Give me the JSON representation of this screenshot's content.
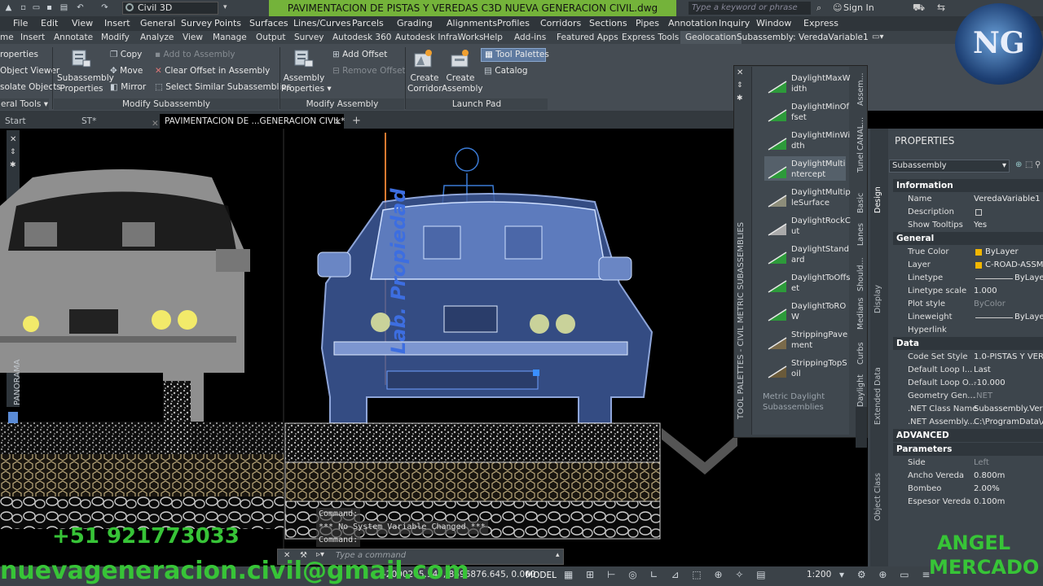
{
  "workspace": "Civil 3D",
  "document_title": "PAVIMENTACION DE PISTAS Y VEREDAS C3D NUEVA GENERACION CIVIL.dwg",
  "search_placeholder": "Type a keyword or phrase",
  "signin": "Sign In",
  "menu": [
    "File",
    "Edit",
    "View",
    "Insert",
    "General",
    "Survey",
    "Points",
    "Surfaces",
    "Lines/Curves",
    "Parcels",
    "Grading",
    "Alignments",
    "Profiles",
    "Corridors",
    "Sections",
    "Pipes",
    "Annotation",
    "Inquiry",
    "Window",
    "Express"
  ],
  "ribbon_tabs": [
    "me",
    "Insert",
    "Annotate",
    "Modify",
    "Analyze",
    "View",
    "Manage",
    "Output",
    "Survey",
    "Autodesk 360",
    "Autodesk InfraWorks",
    "Help",
    "Add-ins",
    "Featured Apps",
    "Express Tools",
    "Geolocation",
    "Subassembly: VeredaVariable1"
  ],
  "ribbon": {
    "properties_left": [
      "roperties",
      "Object Viewer",
      "solate Objects",
      "eral Tools"
    ],
    "subassembly_properties": [
      "Subassembly",
      "Properties"
    ],
    "copy": "Copy",
    "move": "Move",
    "mirror": "Mirror",
    "add_to_assembly": "Add to Assembly",
    "clear_offset": "Clear Offset in Assembly",
    "select_similar": "Select Similar Subassemblies",
    "modify_subassembly_label": "Modify Subassembly",
    "assembly_properties": [
      "Assembly",
      "Properties"
    ],
    "add_offset": "Add Offset",
    "remove_offset": "Remove Offset",
    "modify_assembly_label": "Modify Assembly",
    "create_corridor": [
      "Create",
      "Corridor"
    ],
    "create_assembly": [
      "Create",
      "Assembly"
    ],
    "tool_palettes": "Tool Palettes",
    "catalog": "Catalog",
    "launch_pad_label": "Launch Pad"
  },
  "doc_tabs": [
    "Start",
    "ST*",
    "PAVIMENTACION DE ...GENERACION CIVIL*"
  ],
  "palette": {
    "title": "TOOL PALETTES - CIVIL METRIC SUBASSEMBLIES",
    "items": [
      "DaylightMaxWidth",
      "DaylightMinOffset",
      "DaylightMinWidth",
      "DaylightMultiIntercept",
      "DaylightMultipleSurface",
      "DaylightRockCut",
      "DaylightStandard",
      "DaylightToOffset",
      "DaylightToROW",
      "StrippingPavement",
      "StrippingTopSoil"
    ],
    "items_display": [
      [
        "DaylightMaxW",
        "idth"
      ],
      [
        "DaylightMinOf",
        "fset"
      ],
      [
        "DaylightMinWi",
        "dth"
      ],
      [
        "DaylightMulti",
        "ntercept"
      ],
      [
        "DaylightMultip",
        "leSurface"
      ],
      [
        "DaylightRockC",
        "ut"
      ],
      [
        "DaylightStand",
        "ard"
      ],
      [
        "DaylightToOffs",
        "et"
      ],
      [
        "DaylightToRO",
        "W"
      ],
      [
        "StrippingPave",
        "ment"
      ],
      [
        "StrippingTopS",
        "oil"
      ]
    ],
    "footer": [
      "Metric Daylight",
      "Subassemblies"
    ],
    "side_tabs": [
      "Assem...",
      "CANAL...",
      "Tunel",
      "Basic",
      "Lanes",
      "Should...",
      "Medians",
      "Curbs",
      "Daylight"
    ]
  },
  "properties": {
    "title": "PROPERTIES",
    "selector": "Subassembly",
    "side_tabs": [
      "Design",
      "Display",
      "Extended Data",
      "Object Class"
    ],
    "sections": [
      {
        "name": "Information",
        "rows": [
          [
            "Name",
            "VeredaVariable1"
          ],
          [
            "Description",
            ""
          ],
          [
            "Show Tooltips",
            "Yes"
          ]
        ]
      },
      {
        "name": "General",
        "rows": [
          [
            "True Color",
            "ByLayer"
          ],
          [
            "Layer",
            "C-ROAD-ASSM"
          ],
          [
            "Linetype",
            "ByLayer"
          ],
          [
            "Linetype scale",
            "1.000"
          ],
          [
            "Plot style",
            "ByColor"
          ],
          [
            "Lineweight",
            "ByLayer"
          ],
          [
            "Hyperlink",
            ""
          ]
        ]
      },
      {
        "name": "Data",
        "rows": [
          [
            "Code Set Style",
            "1.0-PISTAS Y VERE"
          ],
          [
            "Default Loop I...",
            "Last"
          ],
          [
            "Default Loop O...",
            "-10.000"
          ],
          [
            "Geometry Gen...",
            ".NET"
          ],
          [
            ".NET Class Name",
            "Subassembly.Vered"
          ],
          [
            ".NET Assembly...",
            "C:\\ProgramData\\Au"
          ]
        ]
      },
      {
        "name": "ADVANCED",
        "rows": []
      },
      {
        "name": "Parameters",
        "rows": [
          [
            "Side",
            "Left"
          ],
          [
            "Ancho Vereda",
            "0.800m"
          ],
          [
            "Bombeo",
            "2.00%"
          ],
          [
            "Espesor Vereda",
            "0.100m"
          ]
        ]
      }
    ]
  },
  "command": {
    "history": [
      "Command:",
      "*** No System Variable Changed ***",
      "Command:"
    ],
    "placeholder": "Type a command"
  },
  "status": {
    "coords": "-2000205.547, 8696876.645, 0.000",
    "model": "MODEL",
    "scale": "1:200"
  },
  "canvas_text": {
    "vertical_watermark": "Lab. Propiedad",
    "panorama": "PANORAMA"
  },
  "overlay": {
    "phone": "+51 921773033",
    "email": "nuevageneracion.civil@gmail.com",
    "author": [
      "ANGEL",
      "MERCADO"
    ],
    "logo_text": "NG"
  },
  "colors": {
    "title_green": "#74b33a",
    "accent_blue": "#4a7fd1",
    "watermark_green": "#37c437"
  }
}
